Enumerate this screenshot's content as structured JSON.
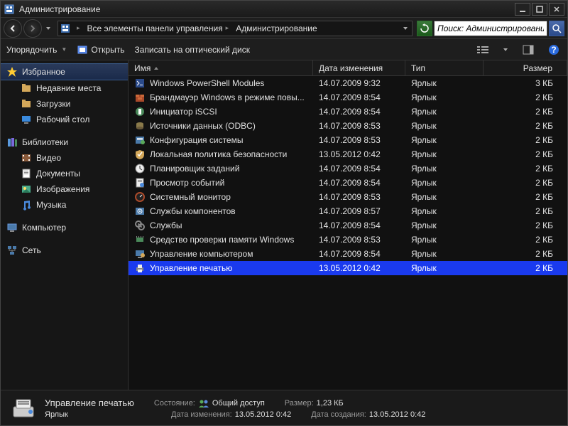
{
  "window": {
    "title": "Администрирование"
  },
  "nav": {
    "crumb1": "Все элементы панели управления",
    "crumb2": "Администрирование",
    "search_placeholder": "Поиск: Администрирование"
  },
  "toolbar": {
    "organize": "Упорядочить",
    "open": "Открыть",
    "burn": "Записать на оптический диск"
  },
  "sidebar": {
    "favorites": "Избранное",
    "fav_items": [
      "Недавние места",
      "Загрузки",
      "Рабочий стол"
    ],
    "libraries": "Библиотеки",
    "lib_items": [
      "Видео",
      "Документы",
      "Изображения",
      "Музыка"
    ],
    "computer": "Компьютер",
    "network": "Сеть"
  },
  "columns": {
    "name": "Имя",
    "date": "Дата изменения",
    "type": "Тип",
    "size": "Размер"
  },
  "rows": [
    {
      "icon": "powershell",
      "name": "Windows PowerShell Modules",
      "date": "14.07.2009 9:32",
      "type": "Ярлык",
      "size": "3 КБ"
    },
    {
      "icon": "firewall",
      "name": "Брандмауэр Windows в режиме повы...",
      "date": "14.07.2009 8:54",
      "type": "Ярлык",
      "size": "2 КБ"
    },
    {
      "icon": "iscsi",
      "name": "Инициатор iSCSI",
      "date": "14.07.2009 8:54",
      "type": "Ярлык",
      "size": "2 КБ"
    },
    {
      "icon": "odbc",
      "name": "Источники данных (ODBC)",
      "date": "14.07.2009 8:53",
      "type": "Ярлык",
      "size": "2 КБ"
    },
    {
      "icon": "config",
      "name": "Конфигурация системы",
      "date": "14.07.2009 8:53",
      "type": "Ярлык",
      "size": "2 КБ"
    },
    {
      "icon": "secpol",
      "name": "Локальная политика безопасности",
      "date": "13.05.2012 0:42",
      "type": "Ярлык",
      "size": "2 КБ"
    },
    {
      "icon": "sched",
      "name": "Планировщик заданий",
      "date": "14.07.2009 8:54",
      "type": "Ярлык",
      "size": "2 КБ"
    },
    {
      "icon": "eventvwr",
      "name": "Просмотр событий",
      "date": "14.07.2009 8:54",
      "type": "Ярлык",
      "size": "2 КБ"
    },
    {
      "icon": "perfmon",
      "name": "Системный монитор",
      "date": "14.07.2009 8:53",
      "type": "Ярлык",
      "size": "2 КБ"
    },
    {
      "icon": "compsvc",
      "name": "Службы компонентов",
      "date": "14.07.2009 8:57",
      "type": "Ярлык",
      "size": "2 КБ"
    },
    {
      "icon": "services",
      "name": "Службы",
      "date": "14.07.2009 8:54",
      "type": "Ярлык",
      "size": "2 КБ"
    },
    {
      "icon": "memdiag",
      "name": "Средство проверки памяти Windows",
      "date": "14.07.2009 8:53",
      "type": "Ярлык",
      "size": "2 КБ"
    },
    {
      "icon": "compmgmt",
      "name": "Управление компьютером",
      "date": "14.07.2009 8:54",
      "type": "Ярлык",
      "size": "2 КБ"
    },
    {
      "icon": "printmgmt",
      "name": "Управление печатью",
      "date": "13.05.2012 0:42",
      "type": "Ярлык",
      "size": "2 КБ",
      "selected": true
    }
  ],
  "status": {
    "name": "Управление печатью",
    "type": "Ярлык",
    "state_label": "Состояние:",
    "state_value": "Общий доступ",
    "mod_label": "Дата изменения:",
    "mod_value": "13.05.2012 0:42",
    "size_label": "Размер:",
    "size_value": "1,23 КБ",
    "created_label": "Дата создания:",
    "created_value": "13.05.2012 0:42"
  }
}
